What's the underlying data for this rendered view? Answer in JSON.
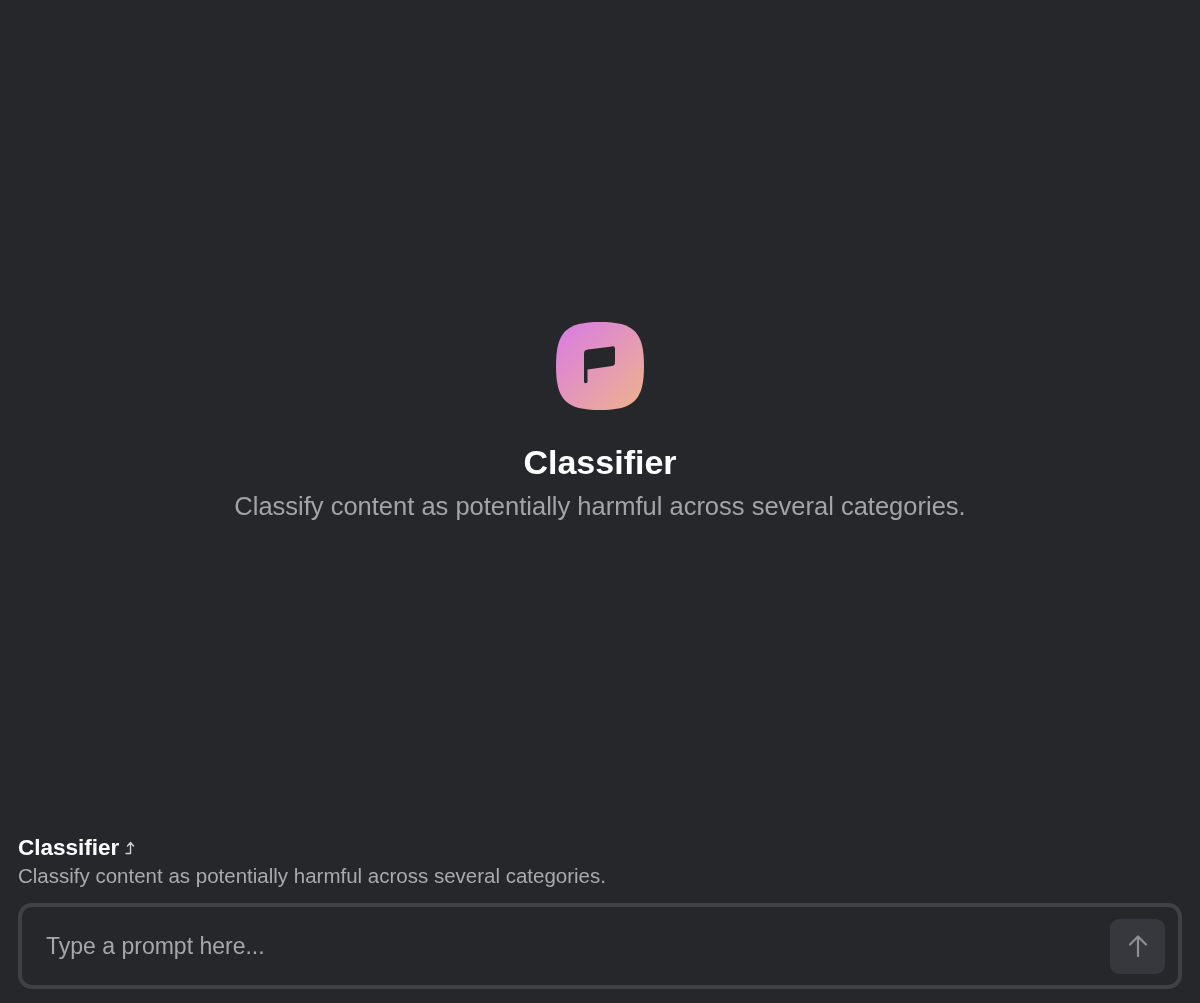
{
  "hero": {
    "title": "Classifier",
    "description": "Classify content as potentially harmful across several categories."
  },
  "composer": {
    "title": "Classifier",
    "description": "Classify content as potentially harmful across several categories.",
    "placeholder": "Type a prompt here..."
  }
}
